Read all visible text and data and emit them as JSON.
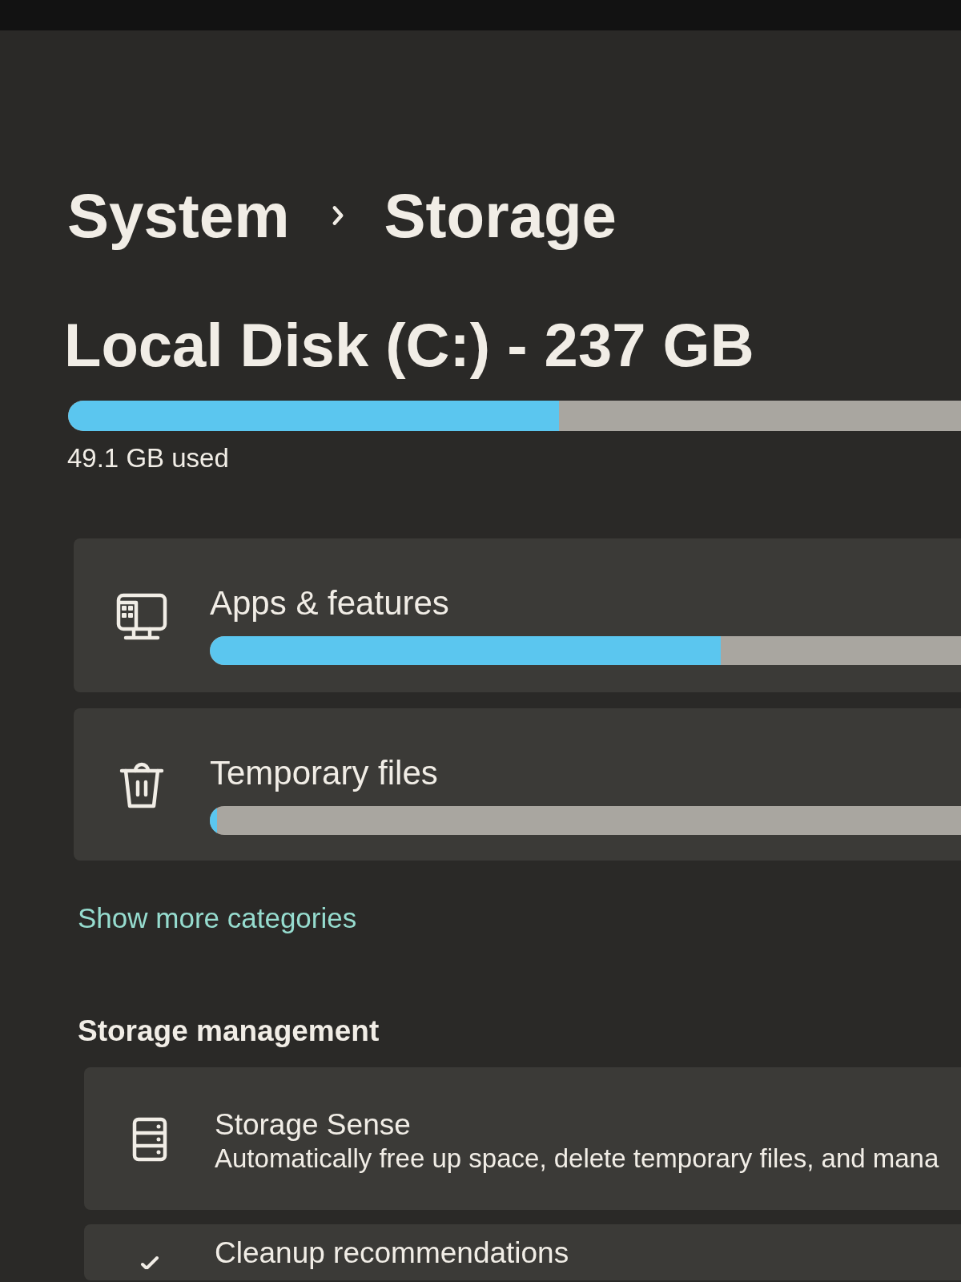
{
  "breadcrumb": {
    "parent": "System",
    "current": "Storage"
  },
  "disk": {
    "title": "Local Disk (C:) - 237 GB",
    "level": 0.55,
    "used": "49.1 GB used"
  },
  "categories": [
    {
      "kind": "apps",
      "label": "Apps & features",
      "level": 0.68
    },
    {
      "kind": "temp",
      "label": "Temporary files",
      "level": 0.01
    }
  ],
  "show_more": "Show more categories",
  "management": {
    "heading": "Storage management",
    "items": [
      {
        "kind": "storage-sense",
        "title": "Storage Sense",
        "description": "Automatically free up space, delete temporary files, and mana"
      },
      {
        "kind": "cleanup",
        "title": "Cleanup recommendations"
      }
    ]
  }
}
